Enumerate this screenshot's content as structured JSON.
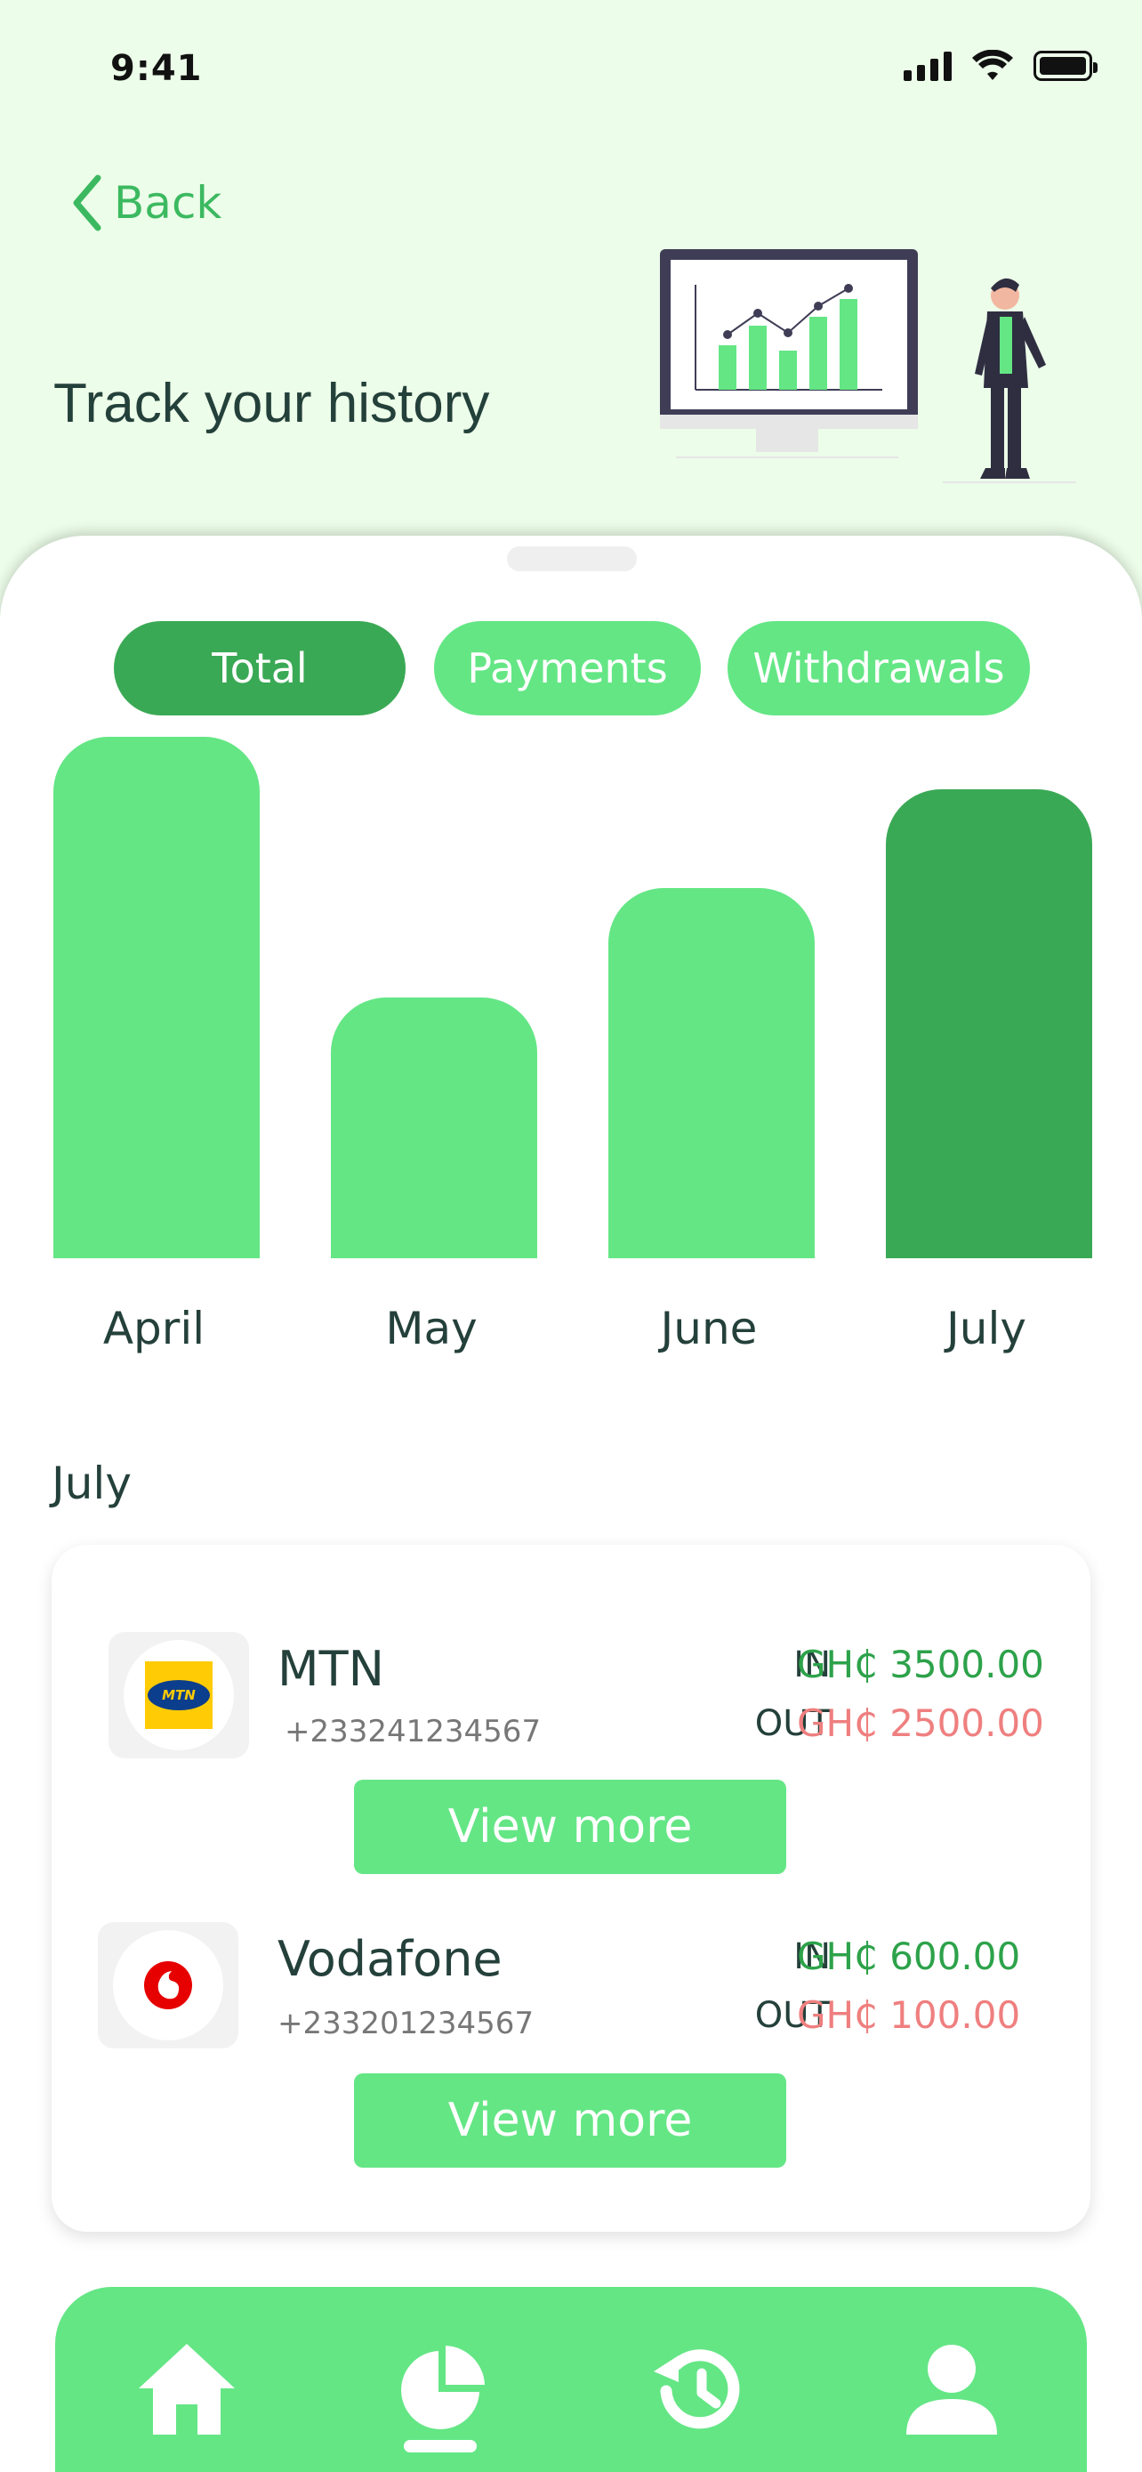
{
  "status_bar": {
    "time": "9:41"
  },
  "header": {
    "back_label": "Back",
    "title": "Track your history"
  },
  "tabs": [
    {
      "label": "Total",
      "active": true
    },
    {
      "label": "Payments",
      "active": false
    },
    {
      "label": "Withdrawals",
      "active": false
    }
  ],
  "chart_data": {
    "type": "bar",
    "categories": [
      "April",
      "May",
      "June",
      "July"
    ],
    "values": [
      100,
      50,
      71,
      90
    ],
    "highlighted": "July",
    "colors": {
      "bar": "#64e685",
      "highlight": "#3aa955"
    }
  },
  "section": {
    "month": "July"
  },
  "providers": [
    {
      "name": "MTN",
      "phone": "+233241234567",
      "in_label": "IN",
      "in_value": "GH₵ 3500.00",
      "out_label": "OUT",
      "out_value": "GH₵ 2500.00",
      "button": "View more",
      "logo": "mtn-logo"
    },
    {
      "name": "Vodafone",
      "phone": "+233201234567",
      "in_label": "IN",
      "in_value": "GH₵ 600.00",
      "out_label": "OUT",
      "out_value": "GH₵ 100.00",
      "button": "View more",
      "logo": "vodafone-logo"
    }
  ],
  "nav": [
    {
      "icon": "home-icon"
    },
    {
      "icon": "pie-chart-icon",
      "active": true
    },
    {
      "icon": "history-icon"
    },
    {
      "icon": "profile-icon"
    }
  ],
  "colors": {
    "background": "#ecfde9",
    "accent": "#64e685",
    "accent_dark": "#3aa955",
    "in": "#2da24a",
    "out": "#ef7f7f"
  }
}
